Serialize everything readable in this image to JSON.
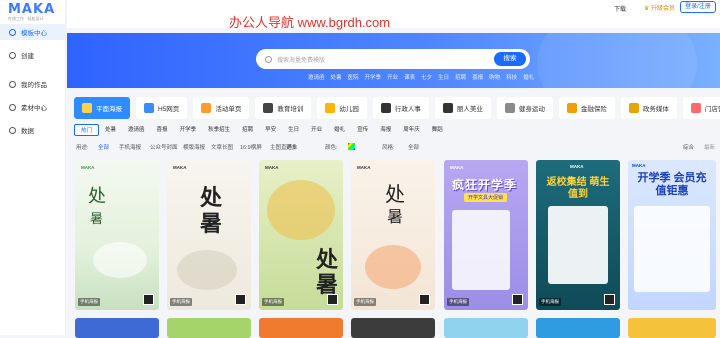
{
  "app": {
    "logo": "MAKA",
    "logo_sub": "在线工作 · 轻松设计",
    "watermark": "办公人导航 www.bgrdh.com"
  },
  "sidebar": {
    "items": [
      {
        "label": "模板中心",
        "active": true
      },
      {
        "label": "创建"
      },
      {
        "label": "我的作品"
      },
      {
        "label": "素材中心"
      },
      {
        "label": "数据"
      }
    ]
  },
  "topbar": {
    "download": "下载",
    "upgrade": "升级会员",
    "login": "登录/注册"
  },
  "search": {
    "placeholder": "搜索海量免费模版",
    "button": "搜索"
  },
  "hotwords": [
    "邀请函",
    "处暑",
    "医院",
    "开学季",
    "开业",
    "课表",
    "七夕",
    "生日",
    "招聘",
    "喜报",
    "购物",
    "科技",
    "婚礼"
  ],
  "categories": [
    {
      "label": "平面海报",
      "active": true,
      "color": "#ffffff"
    },
    {
      "label": "H5网页",
      "color": "#3a8dff"
    },
    {
      "label": "活动单页",
      "color": "#ff9a2e"
    },
    {
      "label": "教育培训",
      "color": "#444444"
    },
    {
      "label": "幼儿园",
      "color": "#ffb400"
    },
    {
      "label": "行政人事",
      "color": "#333333"
    },
    {
      "label": "丽人美业",
      "color": "#333333"
    },
    {
      "label": "健身运动",
      "color": "#8a8a8a"
    },
    {
      "label": "金融保险",
      "color": "#f0a000"
    },
    {
      "label": "政务媒体",
      "color": "#e8a400"
    },
    {
      "label": "门店营销",
      "color": "#ff6a6a"
    }
  ],
  "tags": [
    {
      "label": "热门",
      "active": true
    },
    {
      "label": "处暑"
    },
    {
      "label": "邀请函"
    },
    {
      "label": "喜报"
    },
    {
      "label": "开学季"
    },
    {
      "label": "秋季招生"
    },
    {
      "label": "招聘"
    },
    {
      "label": "早安"
    },
    {
      "label": "生日"
    },
    {
      "label": "开业"
    },
    {
      "label": "婚礼"
    },
    {
      "label": "宣传"
    },
    {
      "label": "海报"
    },
    {
      "label": "周年庆"
    },
    {
      "label": "舞蹈"
    }
  ],
  "filters": {
    "type_label": "用途:",
    "type_options": [
      "全部",
      "手机海报",
      "公众号封面",
      "横版海报",
      "文章长图",
      "16:9横屏",
      "主图直通车",
      "更多"
    ],
    "type_selected": "全部",
    "color_label": "颜色:",
    "style_label": "风格:",
    "style_value": "全部",
    "sort": [
      "综合",
      "最新"
    ]
  },
  "cards": [
    {
      "type_badge": "手机海报",
      "big_text": "处",
      "small_text": "暑"
    },
    {
      "type_badge": "手机海报",
      "big_text": "处",
      "small_text": "暑"
    },
    {
      "type_badge": "手机海报",
      "big_text": "处",
      "small_text": "暑"
    },
    {
      "type_badge": "手机海报",
      "big_text": "处",
      "small_text": "暑"
    },
    {
      "type_badge": "手机海报",
      "title": "疯狂开学季",
      "sub": "开学文具大促销"
    },
    {
      "type_badge": "手机海报",
      "title": "返校集结 萌生值到"
    },
    {
      "type_badge": "",
      "title": "开学季 会员充值钜惠"
    }
  ],
  "colors": {
    "accent": "#1a6bff",
    "banner_start": "#2f63ff",
    "banner_end": "#7ab0ff",
    "watermark": "#e8322b"
  }
}
